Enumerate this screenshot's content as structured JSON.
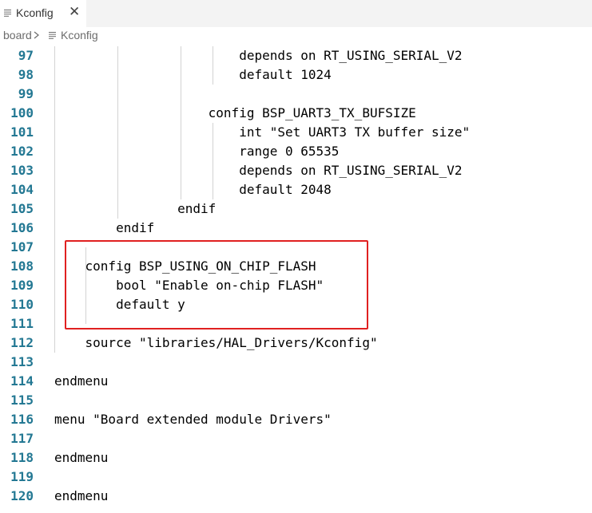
{
  "tab": {
    "icon": "lines-file-icon",
    "label": "Kconfig",
    "close_glyph": "✕"
  },
  "breadcrumb": {
    "folder": "board",
    "separator_icon": "chevron-right-icon",
    "file_icon": "lines-file-icon",
    "file": "Kconfig"
  },
  "editor": {
    "lines": [
      {
        "number": "97",
        "text": "                        depends on RT_USING_SERIAL_V2"
      },
      {
        "number": "98",
        "text": "                        default 1024"
      },
      {
        "number": "99",
        "text": ""
      },
      {
        "number": "100",
        "text": "                    config BSP_UART3_TX_BUFSIZE"
      },
      {
        "number": "101",
        "text": "                        int \"Set UART3 TX buffer size\""
      },
      {
        "number": "102",
        "text": "                        range 0 65535"
      },
      {
        "number": "103",
        "text": "                        depends on RT_USING_SERIAL_V2"
      },
      {
        "number": "104",
        "text": "                        default 2048"
      },
      {
        "number": "105",
        "text": "                endif"
      },
      {
        "number": "106",
        "text": "        endif"
      },
      {
        "number": "107",
        "text": ""
      },
      {
        "number": "108",
        "text": "    config BSP_USING_ON_CHIP_FLASH"
      },
      {
        "number": "109",
        "text": "        bool \"Enable on-chip FLASH\""
      },
      {
        "number": "110",
        "text": "        default y"
      },
      {
        "number": "111",
        "text": ""
      },
      {
        "number": "112",
        "text": "    source \"libraries/HAL_Drivers/Kconfig\""
      },
      {
        "number": "113",
        "text": ""
      },
      {
        "number": "114",
        "text": "endmenu"
      },
      {
        "number": "115",
        "text": ""
      },
      {
        "number": "116",
        "text": "menu \"Board extended module Drivers\""
      },
      {
        "number": "117",
        "text": ""
      },
      {
        "number": "118",
        "text": "endmenu"
      },
      {
        "number": "119",
        "text": ""
      },
      {
        "number": "120",
        "text": "endmenu"
      }
    ]
  },
  "colors": {
    "line_number": "#237893",
    "highlight_border": "#e02020",
    "indent_guide": "#d3d3d3"
  }
}
